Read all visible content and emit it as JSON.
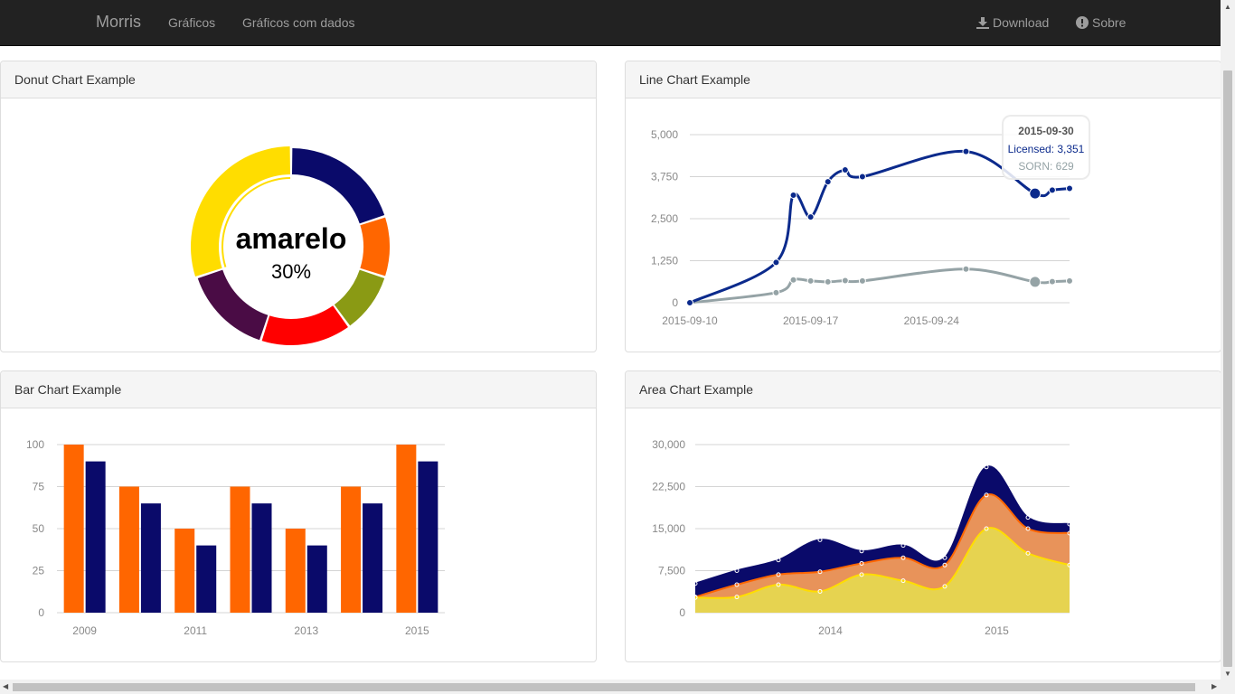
{
  "navbar": {
    "brand": "Morris",
    "links": [
      "Gráficos",
      "Gráficos com dados"
    ],
    "download": "Download",
    "about": "Sobre"
  },
  "panels": {
    "donut": "Donut Chart Example",
    "line": "Line Chart Example",
    "bar": "Bar Chart Example",
    "area": "Area Chart Example"
  },
  "chart_data": [
    {
      "type": "pie",
      "donut": true,
      "selected_label": "amarelo",
      "selected_value": "30%",
      "slices": [
        {
          "value": 30,
          "color": "#ffdd00"
        },
        {
          "value": 20,
          "color": "#0a0a6a"
        },
        {
          "value": 10,
          "color": "#ff6600"
        },
        {
          "value": 10,
          "color": "#8a9a14"
        },
        {
          "value": 15,
          "color": "#ff0000"
        },
        {
          "value": 15,
          "color": "#4a0c45"
        }
      ]
    },
    {
      "type": "line",
      "x": [
        "2015-09-10",
        "2015-09-15",
        "2015-09-16",
        "2015-09-17",
        "2015-09-18",
        "2015-09-19",
        "2015-09-20",
        "2015-09-26",
        "2015-09-30",
        "2015-10-01",
        "2015-10-02"
      ],
      "x_ticks": [
        "2015-09-10",
        "2015-09-17",
        "2015-09-24"
      ],
      "y_ticks": [
        "0",
        "1,250",
        "2,500",
        "3,750",
        "5,000"
      ],
      "ylim": [
        0,
        5000
      ],
      "series": [
        {
          "name": "Licensed",
          "color": "#0b2a8c",
          "values": [
            0,
            1200,
            3200,
            2550,
            3600,
            3950,
            3750,
            4500,
            3250,
            3351,
            3400
          ]
        },
        {
          "name": "SORN",
          "color": "#95a3a6",
          "values": [
            0,
            300,
            680,
            650,
            620,
            660,
            650,
            1000,
            620,
            629,
            650
          ]
        }
      ],
      "tooltip": {
        "date": "2015-09-30",
        "licensed": "Licensed: 3,351",
        "sorn": "SORN: 629"
      }
    },
    {
      "type": "bar",
      "categories": [
        "2009",
        "2010",
        "2011",
        "2012",
        "2013",
        "2014",
        "2015"
      ],
      "x_tick_labels": [
        "2009",
        "",
        "2011",
        "",
        "2013",
        "",
        "2015"
      ],
      "y_ticks": [
        "0",
        "25",
        "50",
        "75",
        "100"
      ],
      "ylim": [
        0,
        100
      ],
      "series": [
        {
          "color": "#ff6600",
          "values": [
            100,
            75,
            50,
            75,
            50,
            75,
            100
          ]
        },
        {
          "color": "#0a0a6a",
          "values": [
            90,
            65,
            40,
            65,
            40,
            65,
            90
          ]
        }
      ]
    },
    {
      "type": "area",
      "x": [
        0,
        1,
        2,
        3,
        4,
        5,
        6,
        7,
        8,
        9
      ],
      "x_ticks": [
        {
          "label": "2014",
          "at": 3.25
        },
        {
          "label": "2015",
          "at": 7.25
        }
      ],
      "y_ticks": [
        "0",
        "7,500",
        "15,000",
        "22,500",
        "30,000"
      ],
      "ylim": [
        0,
        30000
      ],
      "series": [
        {
          "color": "#e6d350",
          "line": "#ffdd00",
          "values": [
            2700,
            2800,
            5000,
            3800,
            6800,
            5700,
            4700,
            15000,
            10600,
            8500
          ]
        },
        {
          "color": "#e8935a",
          "line": "#ff6600",
          "values": [
            2800,
            5000,
            6800,
            7300,
            8800,
            9800,
            8500,
            21000,
            15000,
            14200
          ]
        },
        {
          "color": "#0a0a6a",
          "line": "#0a0a6a",
          "values": [
            5200,
            7500,
            9400,
            13000,
            11000,
            12000,
            9800,
            26000,
            17000,
            15800
          ]
        }
      ]
    }
  ]
}
